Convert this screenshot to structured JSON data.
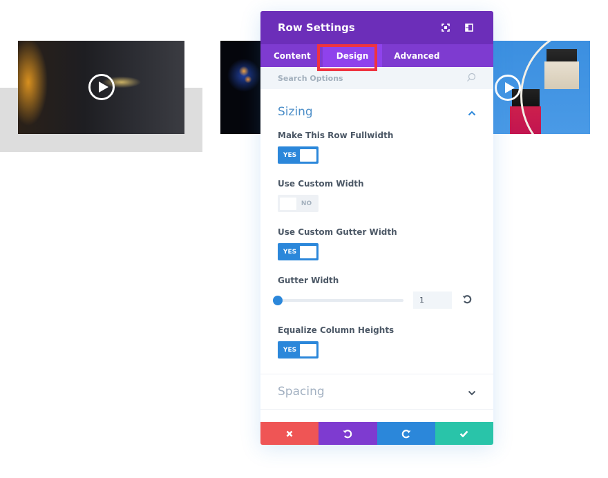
{
  "background": {
    "thumbnails": [
      {
        "name": "guitar-video",
        "has_play_icon": true
      },
      {
        "name": "fireworks-video",
        "has_play_icon": false
      },
      {
        "name": "ferris-wheel-video",
        "has_play_icon": true
      }
    ]
  },
  "modal": {
    "title": "Row Settings",
    "header_icons": [
      "fullscreen-icon",
      "split-view-icon"
    ],
    "tabs": [
      {
        "label": "Content",
        "active": false
      },
      {
        "label": "Design",
        "active": true
      },
      {
        "label": "Advanced",
        "active": false
      }
    ],
    "search": {
      "placeholder": "Search Options",
      "value": ""
    },
    "sections": {
      "sizing": {
        "title": "Sizing",
        "expanded": true,
        "fields": {
          "fullwidth": {
            "label": "Make This Row Fullwidth",
            "state": "YES"
          },
          "custom_width": {
            "label": "Use Custom Width",
            "state": "NO"
          },
          "custom_gutter": {
            "label": "Use Custom Gutter Width",
            "state": "YES"
          },
          "gutter_width": {
            "label": "Gutter Width",
            "value": "1",
            "min": 1,
            "max": 4
          },
          "equalize": {
            "label": "Equalize Column Heights",
            "state": "YES"
          }
        }
      },
      "spacing": {
        "title": "Spacing",
        "expanded": false
      }
    },
    "footer": {
      "buttons": [
        {
          "name": "discard",
          "icon": "close-icon",
          "color": "#ef5555"
        },
        {
          "name": "undo",
          "icon": "undo-icon",
          "color": "#7e3bd0"
        },
        {
          "name": "redo",
          "icon": "redo-icon",
          "color": "#2b87da"
        },
        {
          "name": "save",
          "icon": "check-icon",
          "color": "#29c4a9"
        }
      ]
    }
  },
  "colors": {
    "header": "#6c2eb9",
    "tabs": "#7e3bd0",
    "active_tab": "#8f42ec",
    "highlight": "#ef3340",
    "accent": "#2b87da"
  }
}
